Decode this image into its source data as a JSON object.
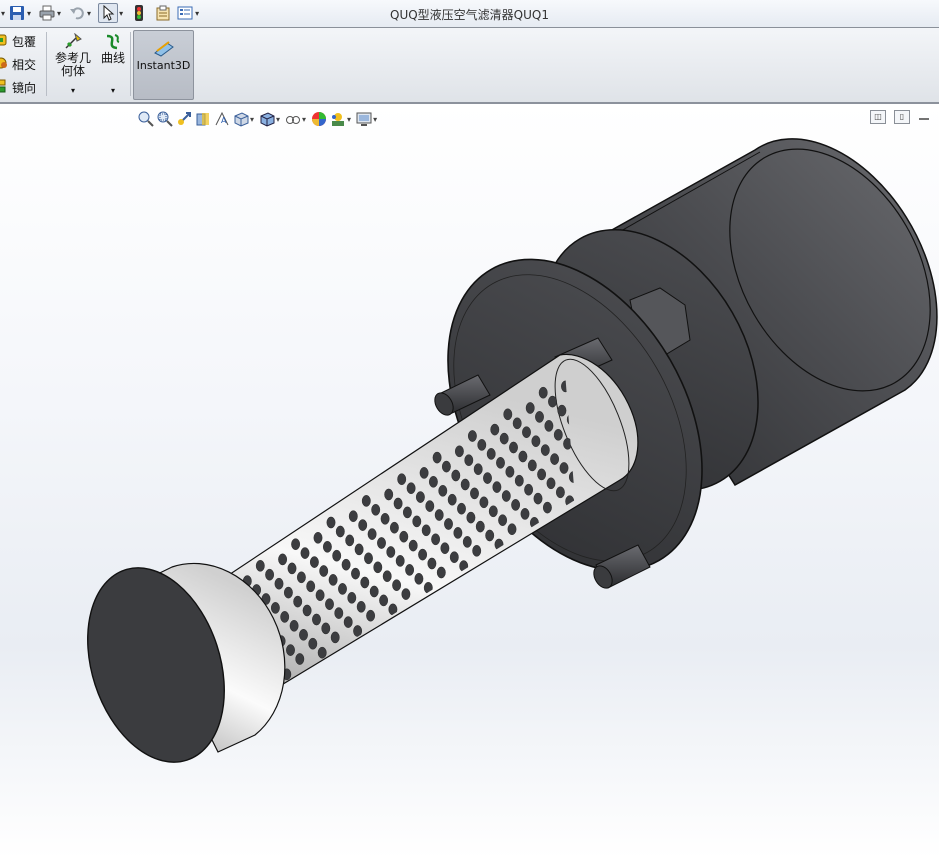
{
  "window": {
    "title": "QUQ型液压空气滤清器QUQ1"
  },
  "quick_access": [
    {
      "name": "save-icon",
      "has_dropdown": true
    },
    {
      "name": "print-icon",
      "has_dropdown": true
    },
    {
      "name": "undo-icon",
      "has_dropdown": true
    },
    {
      "name": "select-pointer-icon",
      "has_dropdown": true
    },
    {
      "name": "rebuild-traffic-light-icon",
      "has_dropdown": false
    },
    {
      "name": "file-properties-icon",
      "has_dropdown": false
    },
    {
      "name": "options-icon",
      "has_dropdown": true
    }
  ],
  "ribbon": {
    "small_items": [
      {
        "label": "包覆",
        "icon": "wrap-icon"
      },
      {
        "label": "相交",
        "icon": "intersect-icon"
      },
      {
        "label": "镜向",
        "icon": "mirror-icon"
      }
    ],
    "reference_geometry": {
      "label_line1": "参考几",
      "label_line2": "何体",
      "icon": "reference-geometry-icon"
    },
    "curves": {
      "label": "曲线",
      "icon": "curves-icon"
    },
    "instant3d": {
      "label": "Instant3D",
      "icon": "instant3d-icon"
    }
  },
  "heads_up_toolbar": [
    {
      "name": "zoom-to-fit-icon",
      "has_dropdown": false
    },
    {
      "name": "zoom-to-area-icon",
      "has_dropdown": false
    },
    {
      "name": "previous-view-icon",
      "has_dropdown": false
    },
    {
      "name": "section-view-icon",
      "has_dropdown": false
    },
    {
      "name": "dynamic-annotation-icon",
      "has_dropdown": false
    },
    {
      "name": "view-orientation-icon",
      "has_dropdown": true
    },
    {
      "name": "display-style-icon",
      "has_dropdown": true
    },
    {
      "name": "hide-show-items-icon",
      "has_dropdown": true
    },
    {
      "name": "edit-appearance-icon",
      "has_dropdown": false
    },
    {
      "name": "apply-scene-icon",
      "has_dropdown": true
    },
    {
      "name": "view-settings-icon",
      "has_dropdown": true
    }
  ],
  "window_controls": [
    {
      "name": "restore-pane-icon"
    },
    {
      "name": "split-pane-icon"
    },
    {
      "name": "minimize-pane-icon"
    }
  ],
  "colors": {
    "model_dark": "#3a3b3e",
    "model_edge": "#111111",
    "perforated_tube": "#f2f2f2",
    "accent_blue": "#1f5fb3"
  }
}
